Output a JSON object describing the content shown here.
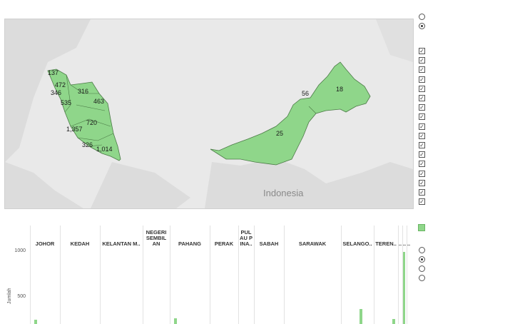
{
  "map": {
    "country_label": "Indonesia",
    "fill_color": "#8fd68a",
    "region_values": [
      {
        "id": "perlis",
        "value": "137"
      },
      {
        "id": "kedah",
        "value": "472"
      },
      {
        "id": "penang",
        "value": "346"
      },
      {
        "id": "kelantan",
        "value": "316"
      },
      {
        "id": "terengganu",
        "value": "463"
      },
      {
        "id": "perak",
        "value": "535"
      },
      {
        "id": "pahang",
        "value": "720"
      },
      {
        "id": "selangor",
        "value": "1,357"
      },
      {
        "id": "negeri-sembilan",
        "value": "326"
      },
      {
        "id": "johor",
        "value": "1,014"
      },
      {
        "id": "labuan",
        "value": "56"
      },
      {
        "id": "sabah",
        "value": "18"
      },
      {
        "id": "sarawak",
        "value": "25"
      }
    ]
  },
  "controls": {
    "top_radios": [
      {
        "selected": false
      },
      {
        "selected": true
      }
    ],
    "checkbox_count": 17,
    "bottom_radios": [
      {
        "selected": false
      },
      {
        "selected": true
      },
      {
        "selected": false
      },
      {
        "selected": false
      }
    ],
    "legend_color": "#8fd68a"
  },
  "chart_data": {
    "type": "bar",
    "ylabel": "Jumlah",
    "yticks": [
      "1000",
      "500"
    ],
    "ylim": [
      0,
      1100
    ],
    "categories": [
      "JOHOR",
      "KEDAH",
      "KELANTAN M..",
      "NEGERI SEMBIL AN",
      "PAHANG",
      "PERAK",
      "PUL AU P INA..",
      "SABAH",
      "SARAWAK",
      "SELANGO..",
      "TEREN..",
      "..",
      "..",
      ".."
    ],
    "values": [
      60,
      0,
      0,
      0,
      75,
      0,
      0,
      0,
      0,
      0,
      0,
      990,
      0,
      0
    ],
    "extra_bars": [
      {
        "category": "SELANGO..",
        "value": 205
      },
      {
        "category": "TEREN..",
        "value": 70
      }
    ]
  }
}
